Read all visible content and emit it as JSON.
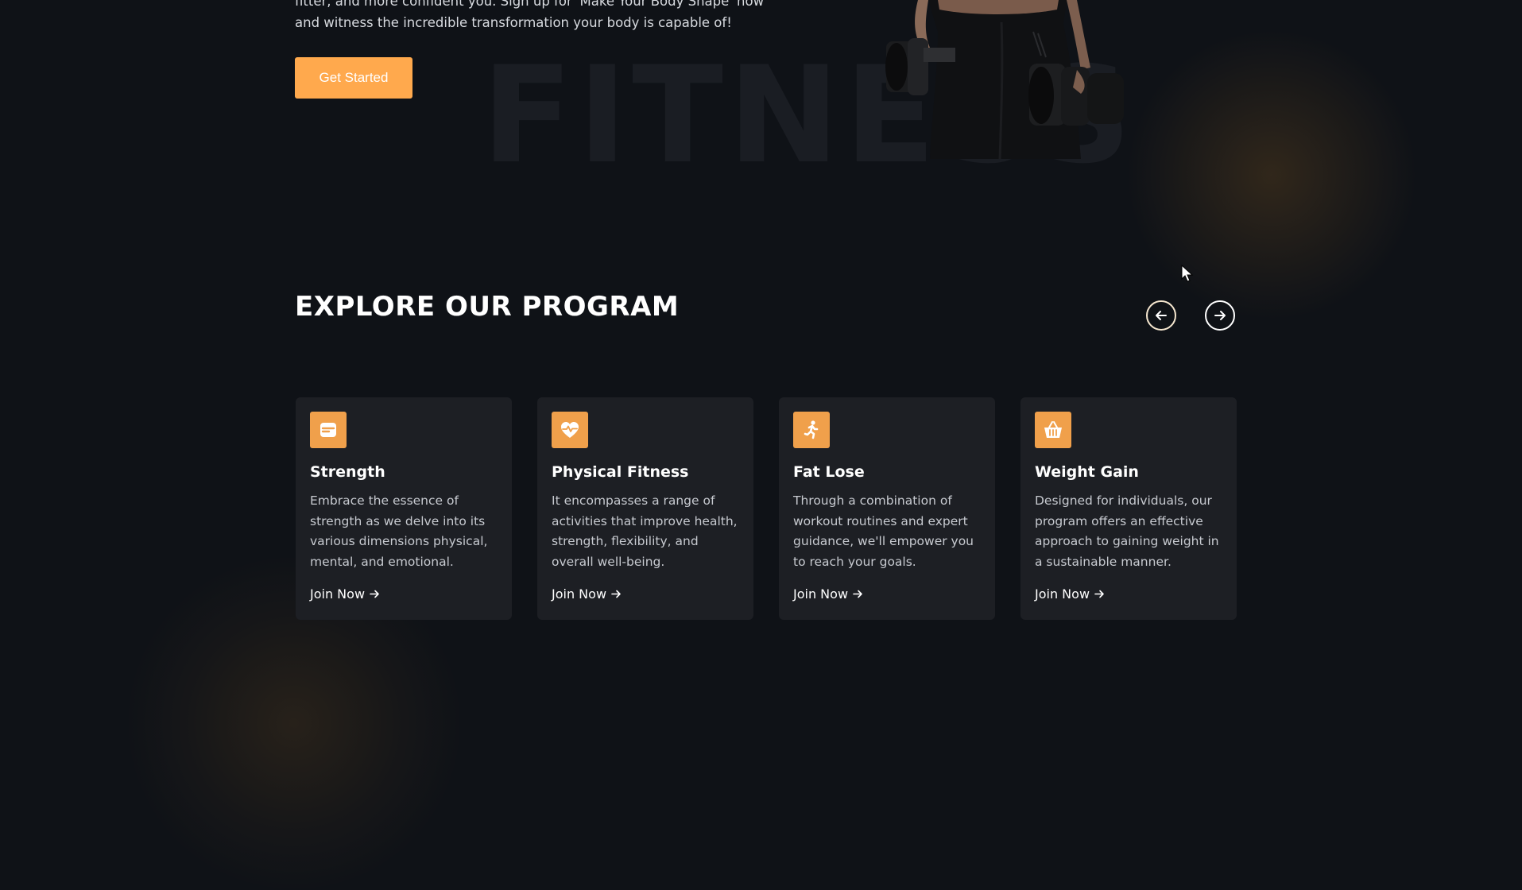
{
  "hero": {
    "text_line1": "fitter, and more confident you. Sign up for 'Make Your Body Shape' now",
    "text_line2": "and witness the incredible transformation your body is capable of!",
    "cta_label": "Get Started",
    "background_word": "FITNESS"
  },
  "programs": {
    "title": "EXPLORE OUR PROGRAM",
    "prev_icon": "arrow-left-icon",
    "next_icon": "arrow-right-icon",
    "cards": [
      {
        "icon": "strength-icon",
        "title": "Strength",
        "description": "Embrace the essence of strength as we delve into its various dimensions physical, mental, and emotional.",
        "link_label": "Join Now"
      },
      {
        "icon": "heart-pulse-icon",
        "title": "Physical Fitness",
        "description": "It encompasses a range of activities that improve health, strength, flexibility, and overall well-being.",
        "link_label": "Join Now"
      },
      {
        "icon": "running-icon",
        "title": "Fat Lose",
        "description": "Through a combination of workout routines and expert guidance, we'll empower you to reach your goals.",
        "link_label": "Join Now"
      },
      {
        "icon": "basket-icon",
        "title": "Weight Gain",
        "description": "Designed for individuals, our program offers an effective approach to gaining weight in a sustainable manner.",
        "link_label": "Join Now"
      }
    ]
  },
  "colors": {
    "background": "#0f1217",
    "accent": "#ffa94d",
    "card_background": "#1d1f24",
    "icon_background": "#f0a04b"
  }
}
